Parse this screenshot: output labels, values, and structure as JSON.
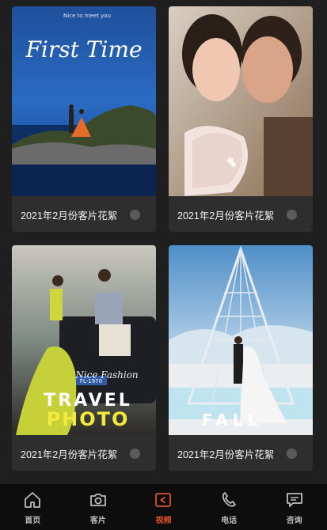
{
  "cards": [
    {
      "caption": "2021年2月份客片花絮",
      "overlay": {
        "script_title": "First Time",
        "tagline": "Nice to meet you"
      }
    },
    {
      "caption": "2021年2月份客片花絮"
    },
    {
      "caption": "2021年2月份客片花絮",
      "overlay": {
        "script_title": "Nice Fashion",
        "line1": "TRAVEL",
        "line2": "PHOTO",
        "plate": "FL-1970"
      }
    },
    {
      "caption": "2021年2月份客片花絮",
      "overlay": {
        "line1": "FALL"
      }
    }
  ],
  "tabbar": {
    "active": "视频",
    "accent_color": "#e0542a",
    "items": [
      {
        "label": "首页",
        "icon": "home-icon"
      },
      {
        "label": "客片",
        "icon": "camera-icon"
      },
      {
        "label": "视频",
        "icon": "video-icon"
      },
      {
        "label": "电话",
        "icon": "phone-icon"
      },
      {
        "label": "咨询",
        "icon": "chat-icon"
      }
    ]
  }
}
